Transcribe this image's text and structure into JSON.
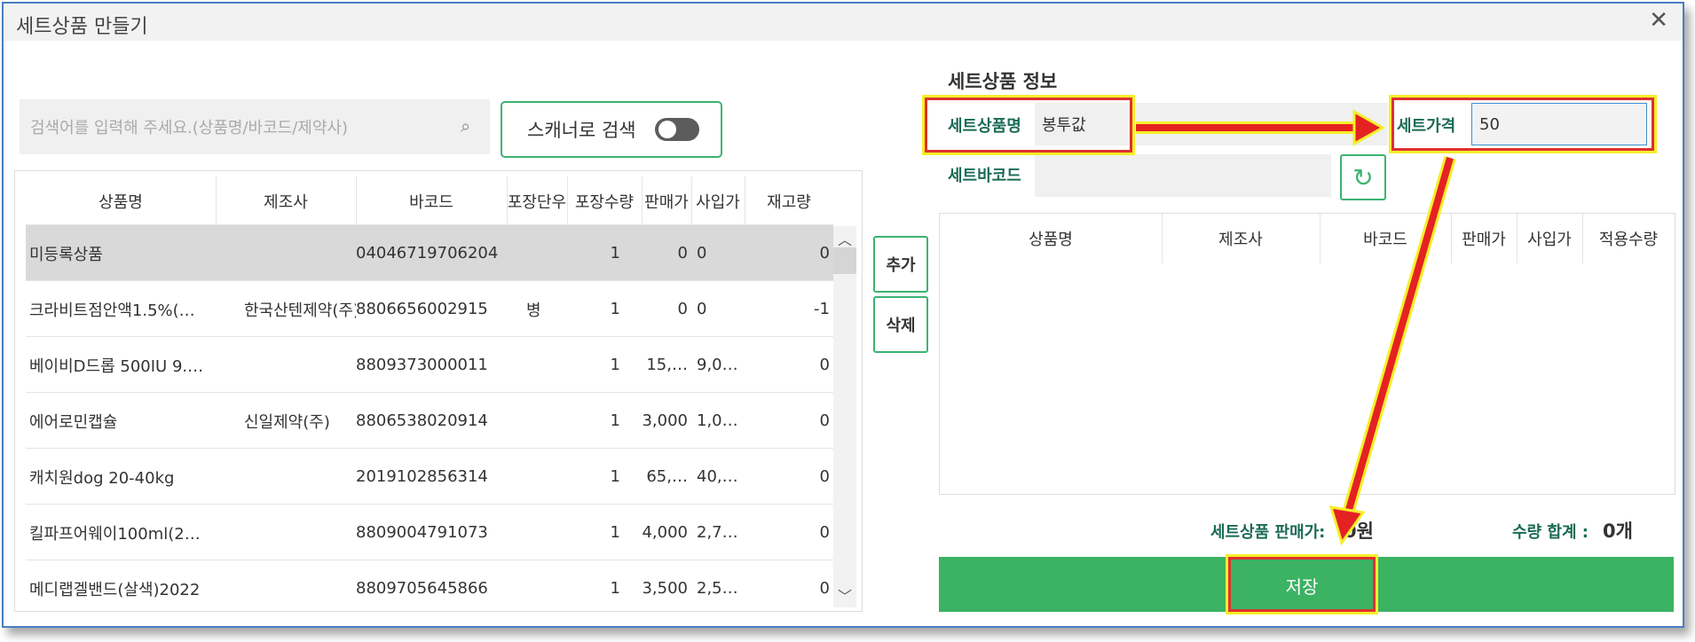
{
  "window": {
    "title": "세트상품 만들기",
    "close_icon": "close-icon"
  },
  "search": {
    "placeholder": "검색어를 입력해 주세요.(상품명/바코드/제약사)",
    "scanner_label": "스캐너로 검색",
    "scanner_on": false
  },
  "product_table": {
    "headers": [
      "상품명",
      "제조사",
      "바코드",
      "포장단우",
      "포장수량",
      "판매가",
      "사입가",
      "재고량"
    ],
    "rows": [
      [
        "미등록상품",
        "",
        "04046719706204",
        "",
        "1",
        "0",
        "0",
        "0"
      ],
      [
        "크라비트점안액1.5%(…",
        "한국산텐제약(주)",
        "8806656002915",
        "병",
        "1",
        "0",
        "0",
        "-1"
      ],
      [
        "베이비D드롭 500IU 9.…",
        "",
        "8809373000011",
        "",
        "1",
        "15,…",
        "9,0…",
        "0"
      ],
      [
        "에어로민캡슐",
        "신일제약(주)",
        "8806538020914",
        "",
        "1",
        "3,000",
        "1,0…",
        "0"
      ],
      [
        "캐치원dog 20-40kg",
        "",
        "2019102856314",
        "",
        "1",
        "65,…",
        "40,…",
        "0"
      ],
      [
        "킬파프어웨이100ml(2…",
        "",
        "8809004791073",
        "",
        "1",
        "4,000",
        "2,7…",
        "0"
      ],
      [
        "메디랩겔밴드(살색)2022",
        "",
        "8809705645866",
        "",
        "1",
        "3,500",
        "2,5…",
        "0"
      ]
    ],
    "selected_row": 0
  },
  "buttons": {
    "add": "추가",
    "delete": "삭제",
    "save": "저장"
  },
  "set_info": {
    "title": "세트상품 정보",
    "name_label": "세트상품명",
    "name_value": "봉투값",
    "price_label": "세트가격",
    "price_value": "50",
    "barcode_label": "세트바코드",
    "barcode_value": ""
  },
  "set_table": {
    "headers": [
      "상품명",
      "제조사",
      "바코드",
      "판매가",
      "사입가",
      "적용수량"
    ]
  },
  "summary": {
    "price_label": "세트상품 판매가:",
    "price_value": "0원",
    "qty_label": "수량 합계 :",
    "qty_value": "0개"
  },
  "colors": {
    "accent_green": "#3cb263",
    "label_green": "#1a6b55",
    "highlight_red": "#e03030",
    "highlight_yellow": "#f5ef2b"
  }
}
